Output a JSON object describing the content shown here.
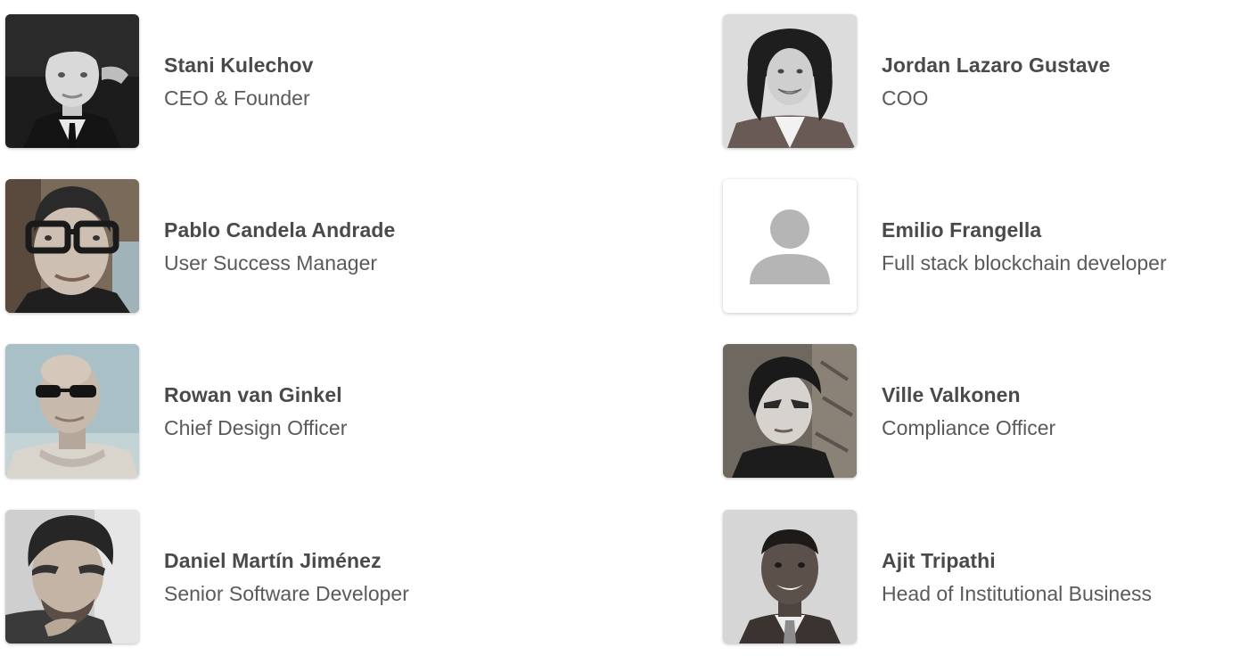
{
  "team": {
    "members": [
      {
        "name": "Stani Kulechov",
        "role": "CEO & Founder",
        "avatar": "photo"
      },
      {
        "name": "Jordan Lazaro Gustave",
        "role": "COO",
        "avatar": "photo"
      },
      {
        "name": "Pablo Candela Andrade",
        "role": "User Success Manager",
        "avatar": "photo"
      },
      {
        "name": "Emilio Frangella",
        "role": "Full stack blockchain developer",
        "avatar": "default-person-icon"
      },
      {
        "name": "Rowan van Ginkel",
        "role": "Chief Design Officer",
        "avatar": "photo"
      },
      {
        "name": "Ville Valkonen",
        "role": "Compliance Officer",
        "avatar": "photo"
      },
      {
        "name": "Daniel Martín Jiménez",
        "role": "Senior Software Developer",
        "avatar": "photo"
      },
      {
        "name": "Ajit Tripathi",
        "role": "Head of Institutional Business",
        "avatar": "photo"
      }
    ]
  },
  "colors": {
    "name_text": "#4a4a4a",
    "role_text": "#5a5a5a",
    "placeholder_icon": "#b5b5b5"
  }
}
